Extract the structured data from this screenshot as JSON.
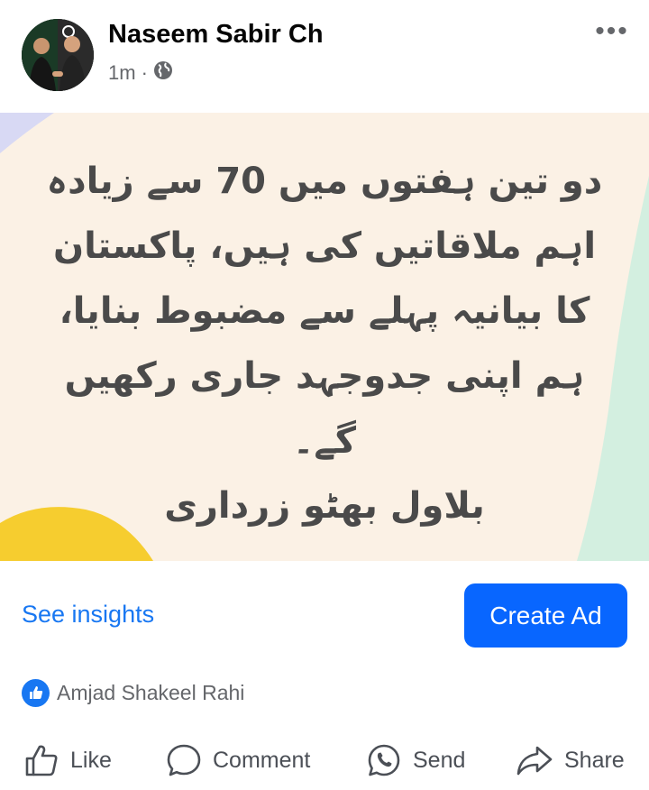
{
  "post": {
    "author": "Naseem Sabir Ch",
    "timestamp": "1m",
    "separator": "·",
    "privacy_icon": "globe-icon",
    "more_label": "•••"
  },
  "image": {
    "lines": [
      "دو تین ہفتوں میں 70 سے زیادہ",
      "اہم ملاقاتیں کی ہیں، پاکستان",
      "کا بیانیہ پہلے سے مضبوط بنایا،",
      "ہم اپنی جدوجہد جاری رکھیں",
      "گے۔",
      "بلاول بھٹو زرداری"
    ],
    "colors": {
      "background": "#fbf1e5",
      "text": "#4a4a4a",
      "yellow_shape": "#f6cd2f",
      "green_shape": "#d3efe0",
      "lavender_shape": "#d8d9f4"
    }
  },
  "insights": {
    "see_insights": "See insights",
    "create_ad": "Create Ad"
  },
  "reactions": {
    "icon": "thumbs-up-icon",
    "names": "Amjad Shakeel Rahi"
  },
  "actions": {
    "like": "Like",
    "comment": "Comment",
    "send": "Send",
    "share": "Share"
  },
  "colors": {
    "accent": "#1877f2",
    "create_ad_bg": "#0866ff",
    "secondary_text": "#65676b"
  }
}
